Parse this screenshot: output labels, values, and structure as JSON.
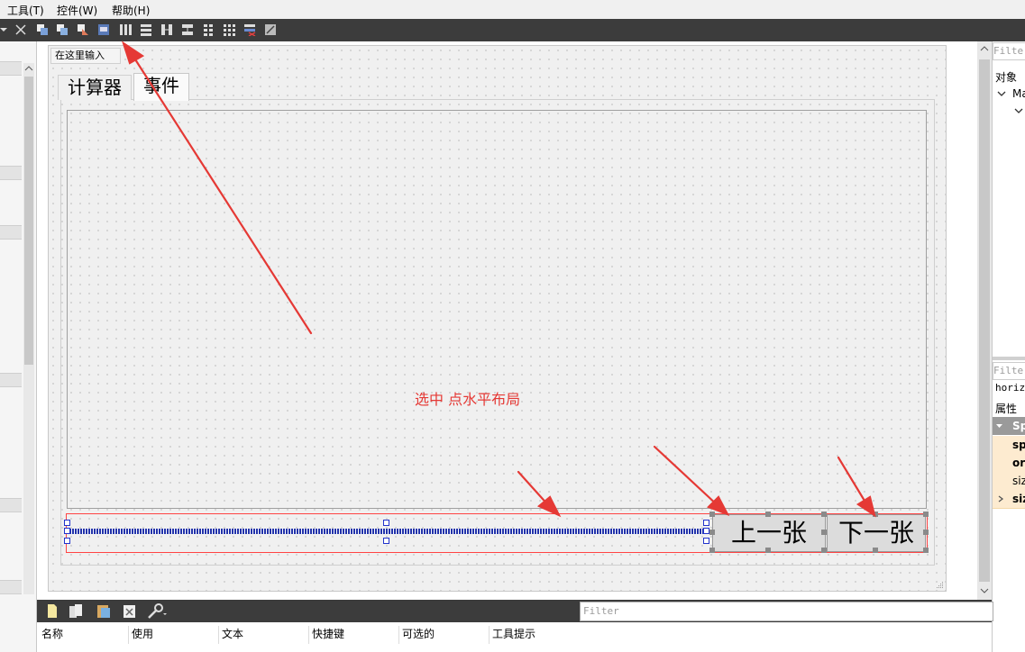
{
  "menu": {
    "items": [
      "工具(T)",
      "控件(W)",
      "帮助(H)"
    ]
  },
  "form": {
    "type_here": "在这里输入",
    "tabs": [
      {
        "label": "计算器"
      },
      {
        "label": "事件"
      }
    ],
    "buttons": {
      "prev": "上一张",
      "next": "下一张"
    }
  },
  "annotation": {
    "text": "选中  点水平布局",
    "color": "#e53935"
  },
  "object_inspector": {
    "filter_placeholder": "Filter",
    "header": "对象",
    "tree_item": "Ma"
  },
  "property_editor": {
    "filter_placeholder": "Filter",
    "object_name": "horizo",
    "header": "属性",
    "group": "Sp",
    "rows": [
      "sp",
      "or",
      "siz",
      "siz"
    ]
  },
  "action_editor": {
    "filter_placeholder": "Filter",
    "columns": [
      "名称",
      "使用",
      "文本",
      "快捷键",
      "可选的",
      "工具提示"
    ]
  },
  "colors": {
    "toolbar": "#3c3c3c",
    "layout_border": "#ff4444",
    "spacer": "#2233aa",
    "property_highlight": "#fdebd0"
  }
}
